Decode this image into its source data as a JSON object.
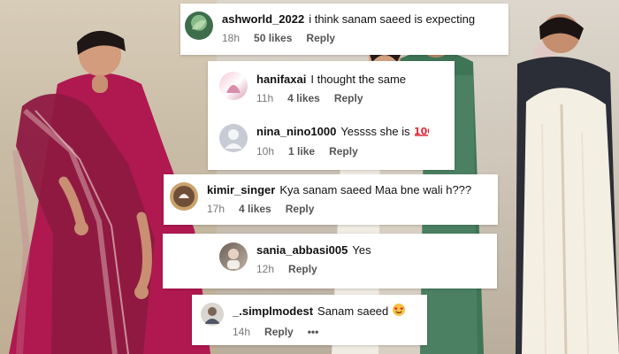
{
  "comments": [
    {
      "username": "ashworld_2022",
      "text": "i think sanam saeed is expecting",
      "time": "18h",
      "likes": "50 likes",
      "reply": "Reply"
    },
    {
      "username": "hanifaxai",
      "text": "I thought the same",
      "time": "11h",
      "likes": "4 likes",
      "reply": "Reply"
    },
    {
      "username": "nina_nino1000",
      "text": "Yessss she is",
      "time": "10h",
      "likes": "1 like",
      "reply": "Reply"
    },
    {
      "username": "kimir_singer",
      "text": "Kya sanam saeed Maa bne wali h???",
      "time": "17h",
      "likes": "4 likes",
      "reply": "Reply"
    },
    {
      "username": "sania_abbasi005",
      "text": "Yes",
      "time": "12h",
      "reply": "Reply"
    },
    {
      "username": "_.simplmodest",
      "text": "Sanam saeed",
      "time": "14h",
      "reply": "Reply",
      "more": "•••"
    }
  ],
  "icons": [
    "hundred-emoji-icon",
    "heart-eyes-emoji-icon",
    "more-options-icon"
  ],
  "colors": {
    "magenta": "#a7164c",
    "green": "#3e7557",
    "cream": "#f4efe3"
  }
}
